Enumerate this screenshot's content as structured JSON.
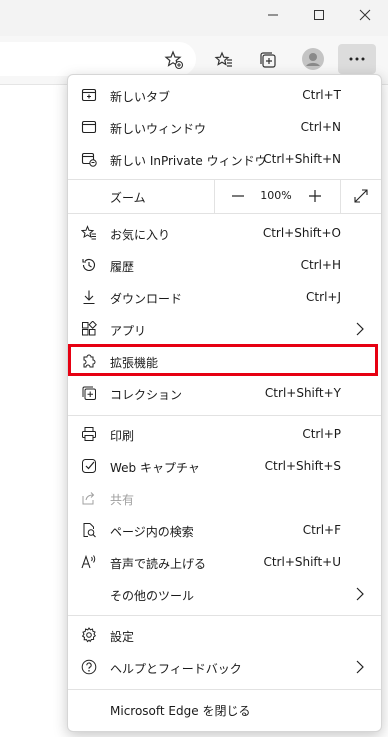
{
  "window": {
    "minimize_icon": "minimize-icon",
    "maximize_icon": "maximize-icon",
    "close_icon": "close-icon"
  },
  "toolbar": {
    "icons": [
      "favorite-add-icon",
      "favorites-icon",
      "collections-icon",
      "profile-icon",
      "more-icon"
    ]
  },
  "menu": {
    "items": [
      {
        "label": "新しいタブ",
        "shortcut": "Ctrl+T",
        "icon": "new-tab-icon"
      },
      {
        "label": "新しいウィンドウ",
        "shortcut": "Ctrl+N",
        "icon": "new-window-icon"
      },
      {
        "label": "新しい InPrivate ウィンドウ",
        "shortcut": "Ctrl+Shift+N",
        "icon": "inprivate-icon"
      }
    ],
    "zoom": {
      "label": "ズーム",
      "value": "100%",
      "minus": "—",
      "plus": "+"
    },
    "items2": [
      {
        "label": "お気に入り",
        "shortcut": "Ctrl+Shift+O",
        "icon": "favorites-icon"
      },
      {
        "label": "履歴",
        "shortcut": "Ctrl+H",
        "icon": "history-icon"
      },
      {
        "label": "ダウンロード",
        "shortcut": "Ctrl+J",
        "icon": "download-icon"
      },
      {
        "label": "アプリ",
        "shortcut": "",
        "icon": "apps-icon"
      },
      {
        "label": "拡張機能",
        "shortcut": "",
        "icon": "extensions-icon"
      },
      {
        "label": "コレクション",
        "shortcut": "Ctrl+Shift+Y",
        "icon": "collections-icon"
      }
    ],
    "items3": [
      {
        "label": "印刷",
        "shortcut": "Ctrl+P",
        "icon": "print-icon"
      },
      {
        "label": "Web キャプチャ",
        "shortcut": "Ctrl+Shift+S",
        "icon": "web-capture-icon"
      },
      {
        "label": "共有",
        "shortcut": "",
        "icon": "share-icon"
      },
      {
        "label": "ページ内の検索",
        "shortcut": "Ctrl+F",
        "icon": "find-icon"
      },
      {
        "label": "音声で読み上げる",
        "shortcut": "Ctrl+Shift+U",
        "icon": "read-aloud-icon"
      },
      {
        "label": "その他のツール",
        "shortcut": "",
        "icon": ""
      }
    ],
    "items4": [
      {
        "label": "設定",
        "shortcut": "",
        "icon": "settings-icon"
      },
      {
        "label": "ヘルプとフィードバック",
        "shortcut": "",
        "icon": "help-icon"
      }
    ],
    "close_label": "Microsoft Edge を閉じる"
  },
  "highlight_color": "#e60012"
}
